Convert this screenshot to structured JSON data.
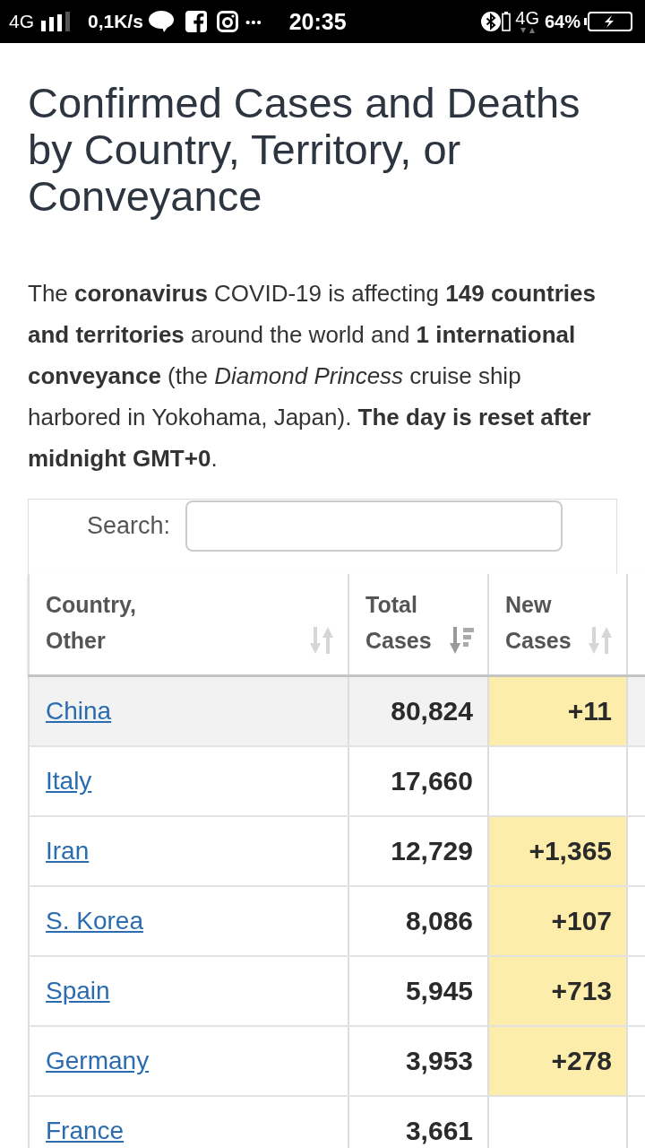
{
  "status_bar": {
    "network": "4G",
    "speed": "0,1K/s",
    "overflow": "•••",
    "time": "20:35",
    "network_right": "4G",
    "battery": "64%"
  },
  "heading": "Confirmed Cases and Deaths by Country, Territory, or Conveyance",
  "intro": "The **coronavirus** COVID-19 is affecting **149 countries and territories** around the world and **1 international conveyance** (the *Diamond Princess* cruise ship harbored in Yokohama, Japan). **The day is reset after midnight GMT+0**.",
  "search": {
    "label": "Search:"
  },
  "table": {
    "columns": [
      {
        "label": "Country, Other",
        "sorted": false
      },
      {
        "label": "Total Cases",
        "sorted": true
      },
      {
        "label": "New Cases",
        "sorted": false
      }
    ],
    "rows": [
      {
        "country": "China",
        "total_cases": "80,824",
        "new_cases": "+11",
        "highlighted": true
      },
      {
        "country": "Italy",
        "total_cases": "17,660",
        "highlighted": false
      },
      {
        "country": "Iran",
        "total_cases": "12,729",
        "new_cases": "+1,365",
        "highlighted": false
      },
      {
        "country": "S. Korea",
        "total_cases": "8,086",
        "new_cases": "+107",
        "highlighted": false
      },
      {
        "country": "Spain",
        "total_cases": "5,945",
        "new_cases": "+713",
        "highlighted": false
      },
      {
        "country": "Germany",
        "total_cases": "3,953",
        "new_cases": "+278",
        "highlighted": false
      },
      {
        "country": "France",
        "total_cases": "3,661",
        "highlighted": false
      }
    ]
  }
}
